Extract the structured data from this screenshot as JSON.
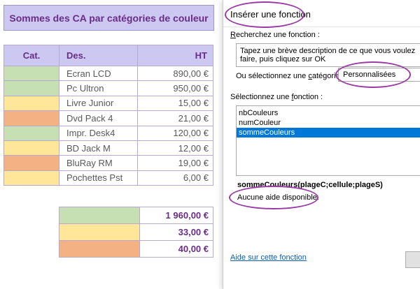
{
  "sheet": {
    "title": "Sommes des CA par catégories de couleur",
    "headers": {
      "cat": "Cat.",
      "des": "Des.",
      "ht": "HT"
    },
    "rows": [
      {
        "color": "#c6e0b4",
        "des": "Ecran LCD",
        "ht": "890,00 €"
      },
      {
        "color": "#c6e0b4",
        "des": "Pc Ultron",
        "ht": "950,00 €"
      },
      {
        "color": "#ffe699",
        "des": "Livre Junior",
        "ht": "15,00 €"
      },
      {
        "color": "#f4b183",
        "des": "Dvd Pack 4",
        "ht": "21,00 €"
      },
      {
        "color": "#c6e0b4",
        "des": "Impr. Desk4",
        "ht": "120,00 €"
      },
      {
        "color": "#ffe699",
        "des": "BD Jack M",
        "ht": "12,00 €"
      },
      {
        "color": "#f4b183",
        "des": "BluRay RM",
        "ht": "19,00 €"
      },
      {
        "color": "#ffe699",
        "des": "Pochettes Pst",
        "ht": "6,00 €"
      }
    ],
    "sums": [
      {
        "color": "#c6e0b4",
        "value": "1 960,00 €"
      },
      {
        "color": "#ffe699",
        "value": "33,00 €"
      },
      {
        "color": "#f4b183",
        "value": "40,00 €"
      }
    ]
  },
  "dialog": {
    "title": "Insérer une fonction",
    "search_label_key": "R",
    "search_label_rest": "echerchez une fonction :",
    "search_text": "Tapez une brève description de ce que vous voulez faire, puis cliquez sur OK",
    "category_label_pre": "Ou sélectionnez une ",
    "category_label_key": "c",
    "category_label_post": "atégorie :",
    "category_value": "Personnalisées",
    "function_label_pre": "Sélectionnez une ",
    "function_label_key": "f",
    "function_label_post": "onction :",
    "functions": [
      "nbCouleurs",
      "numCouleur",
      "sommeCouleurs"
    ],
    "selected_function": "sommeCouleurs",
    "signature": "sommeCouleurs(plageC;cellule;plageS)",
    "description": "Aucune aide disponible.",
    "help_link": "Aide sur cette fonction"
  },
  "colors": {
    "accent_purple": "#6a2d86",
    "header_lavender": "#ccc8f2",
    "annotation": "#9a3aa4",
    "selection_blue": "#0078d7",
    "green": "#c6e0b4",
    "yellow": "#ffe699",
    "orange": "#f4b183"
  }
}
